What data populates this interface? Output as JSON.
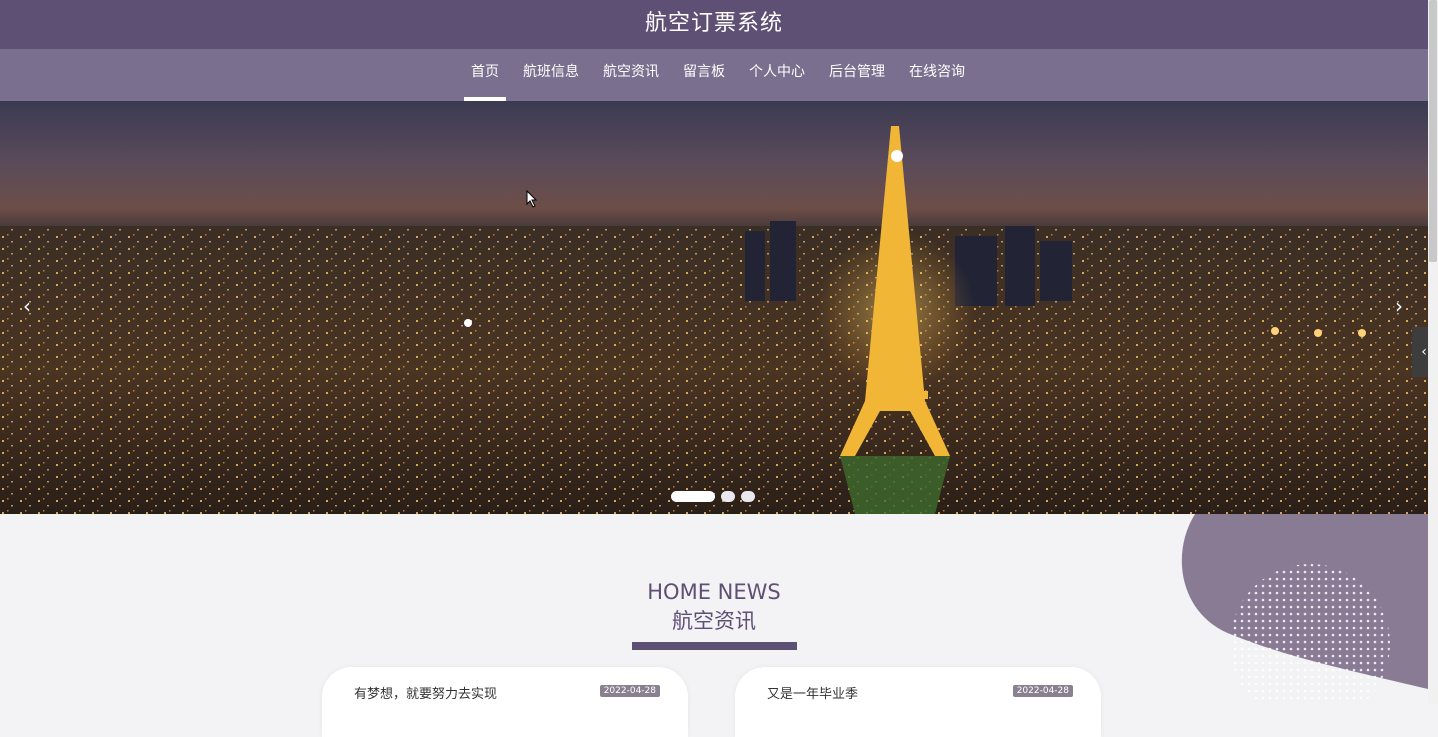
{
  "header": {
    "title": "航空订票系统"
  },
  "nav": {
    "items": [
      {
        "label": "首页",
        "active": true
      },
      {
        "label": "航班信息"
      },
      {
        "label": "航空资讯"
      },
      {
        "label": "留言板"
      },
      {
        "label": "个人中心"
      },
      {
        "label": "后台管理"
      },
      {
        "label": "在线咨询"
      }
    ]
  },
  "carousel": {
    "prev_icon": "chevron-left-icon",
    "next_icon": "chevron-right-icon",
    "slide_count": 3,
    "active_slide": 1
  },
  "section": {
    "title_en": "HOME NEWS",
    "title_cn": "航空资讯"
  },
  "news": [
    {
      "title": "有梦想，就要努力去实现",
      "date": "2022-04-28"
    },
    {
      "title": "又是一年毕业季",
      "date": "2022-04-28"
    }
  ],
  "colors": {
    "primary": "#5e5075",
    "nav_bg": "#7a6f8e",
    "accent_blob": "#8a7b95",
    "page_bg": "#f3f2f4"
  }
}
